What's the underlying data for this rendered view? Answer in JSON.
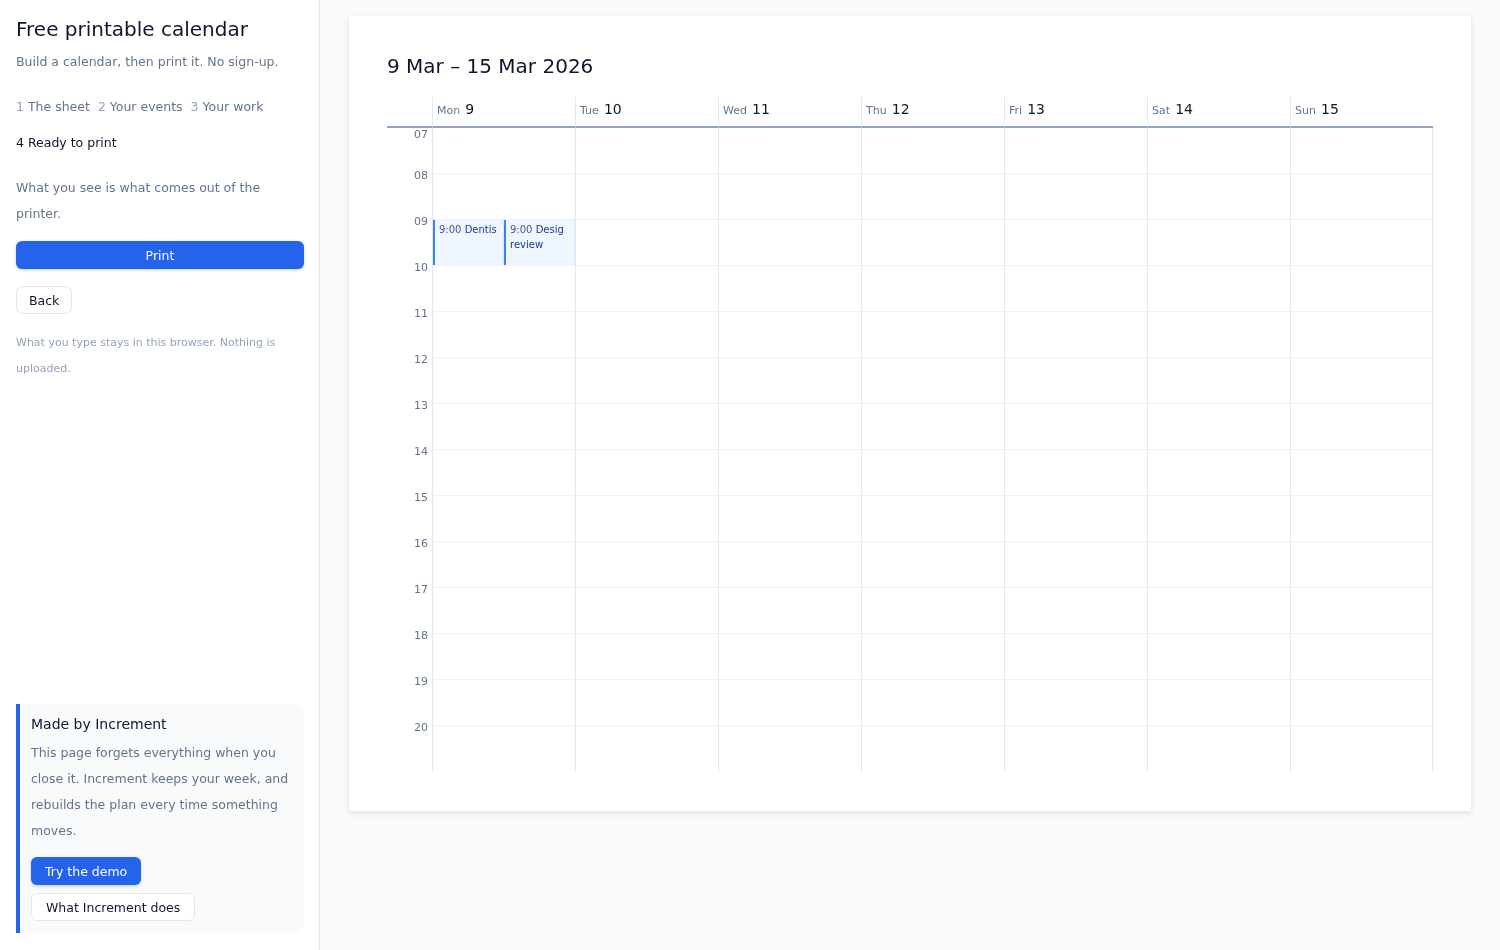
{
  "sidebar": {
    "title": "Free printable calendar",
    "subtitle": "Build a calendar, then print it. No sign-up.",
    "steps": [
      {
        "number": "1",
        "label": "The sheet",
        "selected": false
      },
      {
        "number": "2",
        "label": "Your events",
        "selected": false
      },
      {
        "number": "3",
        "label": "Your work",
        "selected": false
      },
      {
        "number": "4",
        "label": "Ready to print",
        "selected": true
      }
    ],
    "intro": "What you see is what comes out of the printer.",
    "buttons": [
      {
        "label": "Print",
        "kind": "primary"
      },
      {
        "label": "Back",
        "kind": "secondary"
      }
    ],
    "privacy_note": "What you type stays in this browser. Nothing is uploaded.",
    "promo": {
      "title": "Made by Increment",
      "text": "This page forgets everything when you close it. Increment keeps your week, and rebuilds the plan every time something moves.",
      "buttons": [
        {
          "label": "Try the demo",
          "kind": "primary"
        },
        {
          "label": "What Increment does",
          "kind": "secondary"
        }
      ]
    }
  },
  "calendar": {
    "title": "9 Mar – 15 Mar 2026",
    "days": [
      {
        "weekday": "Mon",
        "date": "9",
        "events": [
          {
            "time": "9:00",
            "title_lines": [
              "Dentis"
            ]
          },
          {
            "time": "9:00",
            "title_lines": [
              "Desig",
              "review"
            ]
          }
        ]
      },
      {
        "weekday": "Tue",
        "date": "10"
      },
      {
        "weekday": "Wed",
        "date": "11"
      },
      {
        "weekday": "Thu",
        "date": "12"
      },
      {
        "weekday": "Fri",
        "date": "13"
      },
      {
        "weekday": "Sat",
        "date": "14"
      },
      {
        "weekday": "Sun",
        "date": "15"
      }
    ],
    "hours": [
      "07",
      "08",
      "09",
      "10",
      "11",
      "12",
      "13",
      "14",
      "15",
      "16",
      "17",
      "18",
      "19",
      "20"
    ]
  }
}
